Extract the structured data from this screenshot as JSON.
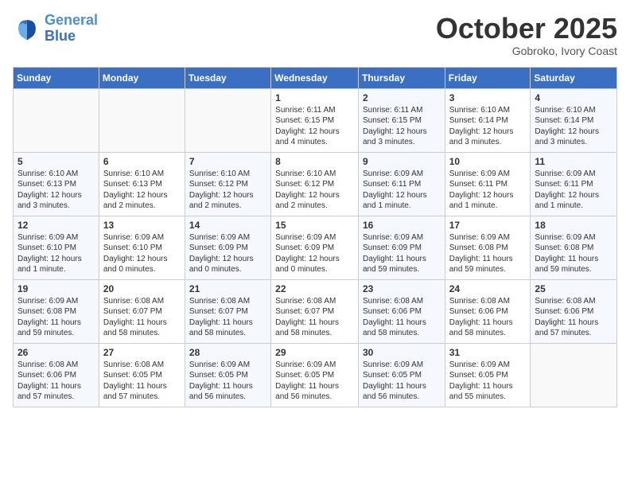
{
  "header": {
    "logo_line1": "General",
    "logo_line2": "Blue",
    "month": "October 2025",
    "location": "Gobroko, Ivory Coast"
  },
  "weekdays": [
    "Sunday",
    "Monday",
    "Tuesday",
    "Wednesday",
    "Thursday",
    "Friday",
    "Saturday"
  ],
  "weeks": [
    [
      {
        "day": "",
        "info": ""
      },
      {
        "day": "",
        "info": ""
      },
      {
        "day": "",
        "info": ""
      },
      {
        "day": "1",
        "info": "Sunrise: 6:11 AM\nSunset: 6:15 PM\nDaylight: 12 hours\nand 4 minutes."
      },
      {
        "day": "2",
        "info": "Sunrise: 6:11 AM\nSunset: 6:15 PM\nDaylight: 12 hours\nand 3 minutes."
      },
      {
        "day": "3",
        "info": "Sunrise: 6:10 AM\nSunset: 6:14 PM\nDaylight: 12 hours\nand 3 minutes."
      },
      {
        "day": "4",
        "info": "Sunrise: 6:10 AM\nSunset: 6:14 PM\nDaylight: 12 hours\nand 3 minutes."
      }
    ],
    [
      {
        "day": "5",
        "info": "Sunrise: 6:10 AM\nSunset: 6:13 PM\nDaylight: 12 hours\nand 3 minutes."
      },
      {
        "day": "6",
        "info": "Sunrise: 6:10 AM\nSunset: 6:13 PM\nDaylight: 12 hours\nand 2 minutes."
      },
      {
        "day": "7",
        "info": "Sunrise: 6:10 AM\nSunset: 6:12 PM\nDaylight: 12 hours\nand 2 minutes."
      },
      {
        "day": "8",
        "info": "Sunrise: 6:10 AM\nSunset: 6:12 PM\nDaylight: 12 hours\nand 2 minutes."
      },
      {
        "day": "9",
        "info": "Sunrise: 6:09 AM\nSunset: 6:11 PM\nDaylight: 12 hours\nand 1 minute."
      },
      {
        "day": "10",
        "info": "Sunrise: 6:09 AM\nSunset: 6:11 PM\nDaylight: 12 hours\nand 1 minute."
      },
      {
        "day": "11",
        "info": "Sunrise: 6:09 AM\nSunset: 6:11 PM\nDaylight: 12 hours\nand 1 minute."
      }
    ],
    [
      {
        "day": "12",
        "info": "Sunrise: 6:09 AM\nSunset: 6:10 PM\nDaylight: 12 hours\nand 1 minute."
      },
      {
        "day": "13",
        "info": "Sunrise: 6:09 AM\nSunset: 6:10 PM\nDaylight: 12 hours\nand 0 minutes."
      },
      {
        "day": "14",
        "info": "Sunrise: 6:09 AM\nSunset: 6:09 PM\nDaylight: 12 hours\nand 0 minutes."
      },
      {
        "day": "15",
        "info": "Sunrise: 6:09 AM\nSunset: 6:09 PM\nDaylight: 12 hours\nand 0 minutes."
      },
      {
        "day": "16",
        "info": "Sunrise: 6:09 AM\nSunset: 6:09 PM\nDaylight: 11 hours\nand 59 minutes."
      },
      {
        "day": "17",
        "info": "Sunrise: 6:09 AM\nSunset: 6:08 PM\nDaylight: 11 hours\nand 59 minutes."
      },
      {
        "day": "18",
        "info": "Sunrise: 6:09 AM\nSunset: 6:08 PM\nDaylight: 11 hours\nand 59 minutes."
      }
    ],
    [
      {
        "day": "19",
        "info": "Sunrise: 6:09 AM\nSunset: 6:08 PM\nDaylight: 11 hours\nand 59 minutes."
      },
      {
        "day": "20",
        "info": "Sunrise: 6:08 AM\nSunset: 6:07 PM\nDaylight: 11 hours\nand 58 minutes."
      },
      {
        "day": "21",
        "info": "Sunrise: 6:08 AM\nSunset: 6:07 PM\nDaylight: 11 hours\nand 58 minutes."
      },
      {
        "day": "22",
        "info": "Sunrise: 6:08 AM\nSunset: 6:07 PM\nDaylight: 11 hours\nand 58 minutes."
      },
      {
        "day": "23",
        "info": "Sunrise: 6:08 AM\nSunset: 6:06 PM\nDaylight: 11 hours\nand 58 minutes."
      },
      {
        "day": "24",
        "info": "Sunrise: 6:08 AM\nSunset: 6:06 PM\nDaylight: 11 hours\nand 58 minutes."
      },
      {
        "day": "25",
        "info": "Sunrise: 6:08 AM\nSunset: 6:06 PM\nDaylight: 11 hours\nand 57 minutes."
      }
    ],
    [
      {
        "day": "26",
        "info": "Sunrise: 6:08 AM\nSunset: 6:06 PM\nDaylight: 11 hours\nand 57 minutes."
      },
      {
        "day": "27",
        "info": "Sunrise: 6:08 AM\nSunset: 6:05 PM\nDaylight: 11 hours\nand 57 minutes."
      },
      {
        "day": "28",
        "info": "Sunrise: 6:09 AM\nSunset: 6:05 PM\nDaylight: 11 hours\nand 56 minutes."
      },
      {
        "day": "29",
        "info": "Sunrise: 6:09 AM\nSunset: 6:05 PM\nDaylight: 11 hours\nand 56 minutes."
      },
      {
        "day": "30",
        "info": "Sunrise: 6:09 AM\nSunset: 6:05 PM\nDaylight: 11 hours\nand 56 minutes."
      },
      {
        "day": "31",
        "info": "Sunrise: 6:09 AM\nSunset: 6:05 PM\nDaylight: 11 hours\nand 55 minutes."
      },
      {
        "day": "",
        "info": ""
      }
    ]
  ]
}
